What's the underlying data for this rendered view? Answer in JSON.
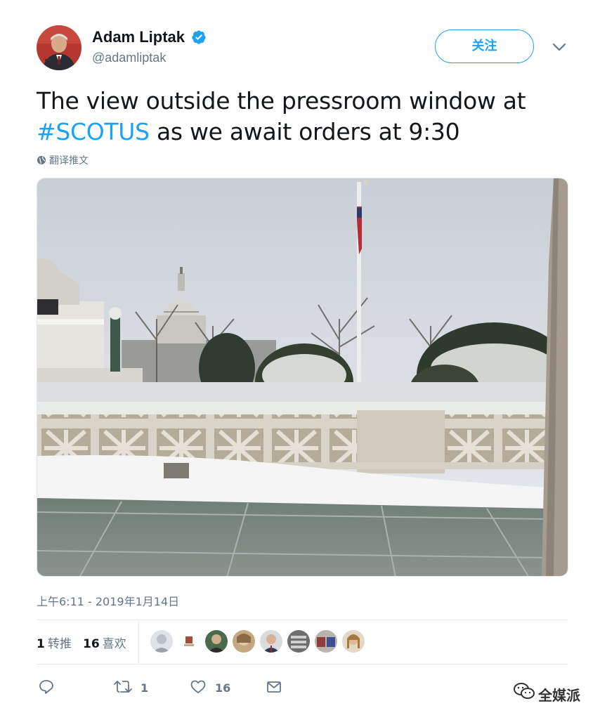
{
  "author": {
    "display_name": "Adam Liptak",
    "handle": "@adamliptak",
    "verified": true
  },
  "follow_button": {
    "label": "关注"
  },
  "tweet": {
    "text_before": "The view outside the pressroom window at ",
    "hashtag": "#SCOTUS",
    "text_after": " as we await orders at 9:30"
  },
  "translate_label": "翻译推文",
  "timestamp": "上午6:11 - 2019年1月14日",
  "stats": {
    "retweets_count": "1",
    "retweets_label": "转推",
    "likes_count": "16",
    "likes_label": "喜欢"
  },
  "actions": {
    "retweet_count": "1",
    "like_count": "16"
  },
  "watermark": "全媒派",
  "colors": {
    "accent": "#1da1f2",
    "secondary_text": "#657786",
    "primary_text": "#14171a"
  }
}
